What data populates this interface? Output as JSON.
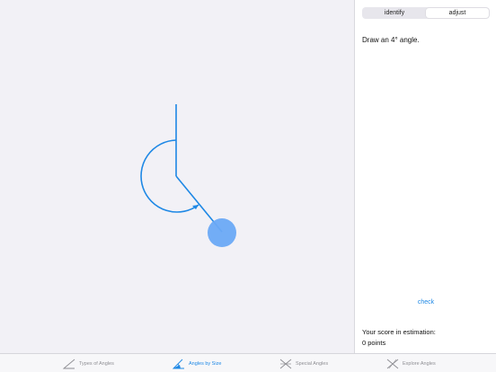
{
  "segments": {
    "identify": "identify",
    "adjust": "adjust",
    "selected": "adjust"
  },
  "prompt": "Draw an 4° angle.",
  "check_label": "check",
  "score": {
    "label": "Your score in estimation:",
    "value": "0 points"
  },
  "tabs": [
    {
      "label": "Types of Angles",
      "icon": "angle-icon",
      "active": false
    },
    {
      "label": "Angles by Size",
      "icon": "protractor-angle-icon",
      "active": true
    },
    {
      "label": "Special Angles",
      "icon": "intersecting-lines-icon",
      "active": false
    },
    {
      "label": "Explore Angles",
      "icon": "explore-lines-icon",
      "active": false
    }
  ],
  "colors": {
    "accent": "#1e88e5",
    "handle": "#6aa9f5",
    "inactive": "#8e8e93"
  }
}
